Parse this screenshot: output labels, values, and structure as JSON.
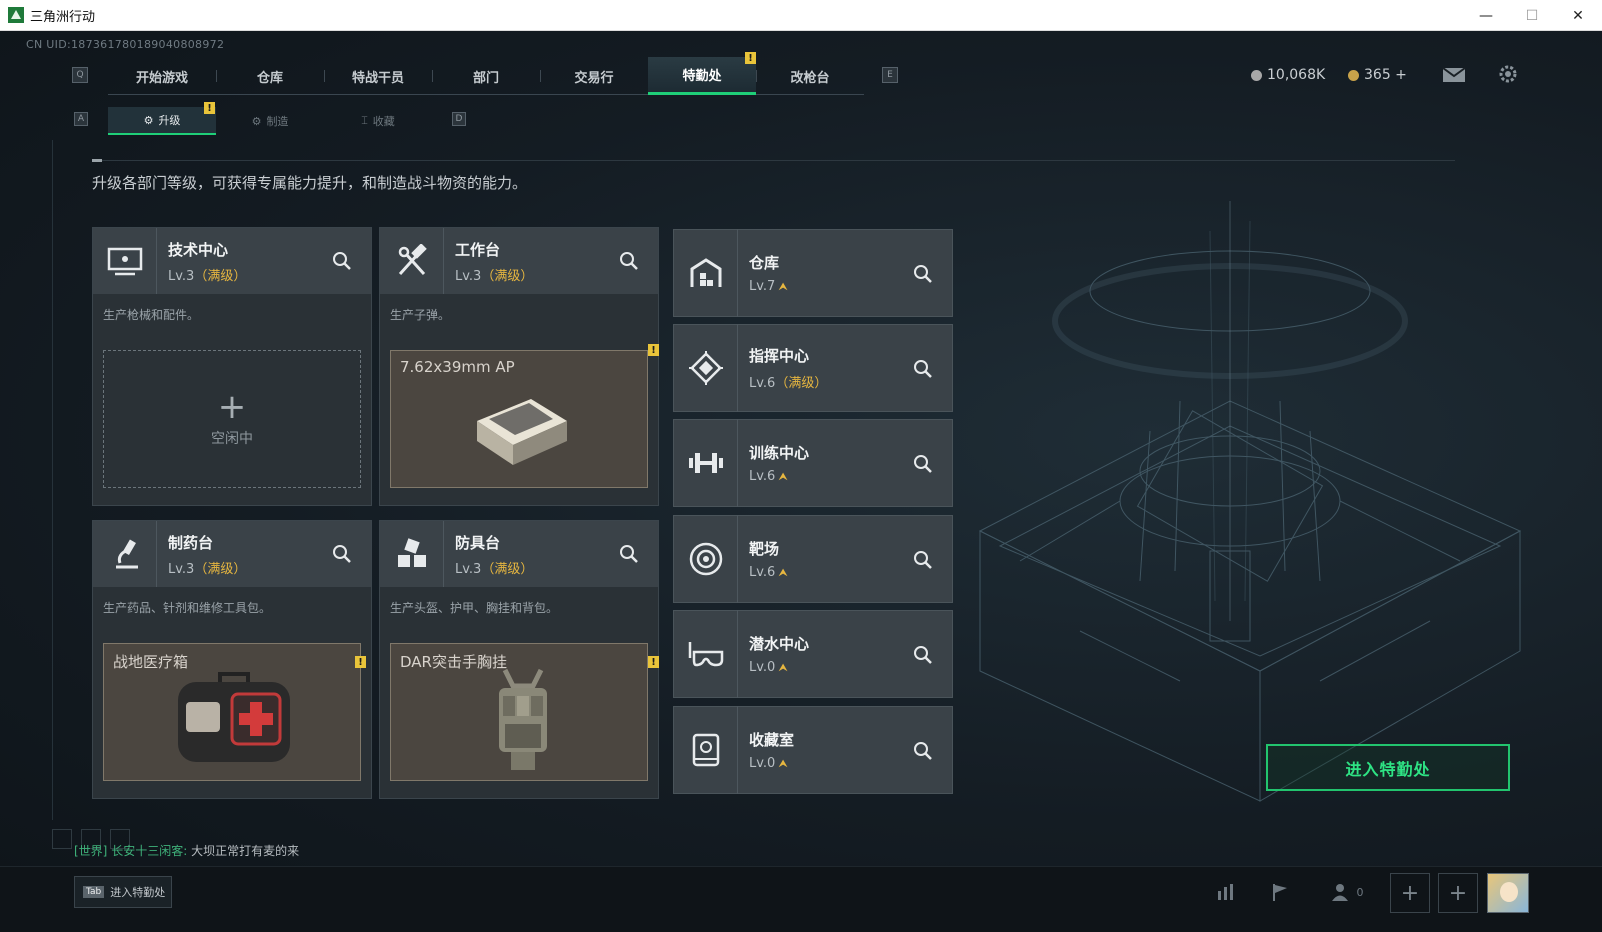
{
  "window": {
    "title": "三角洲行动"
  },
  "header": {
    "uid": "CN UID:187361780189040808972",
    "key_left": "Q",
    "key_right": "E",
    "tabs": [
      {
        "label": "开始游戏",
        "active": false
      },
      {
        "label": "仓库",
        "active": false
      },
      {
        "label": "特战干员",
        "active": false
      },
      {
        "label": "部门",
        "active": false
      },
      {
        "label": "交易行",
        "active": false
      },
      {
        "label": "特勤处",
        "active": true
      },
      {
        "label": "改枪台",
        "active": false
      }
    ],
    "currency": {
      "coins": "10,068K",
      "bonds": "365 +"
    },
    "colors": {
      "accent": "#1fcf78",
      "warning": "#e9c43a",
      "level_max": "#e6b640"
    }
  },
  "subnav": {
    "key_left": "A",
    "key_right": "D",
    "tabs": [
      {
        "label": "升级",
        "icon": "upgrade-icon",
        "active": true
      },
      {
        "label": "制造",
        "icon": "manufacture-icon",
        "active": false
      },
      {
        "label": "收藏",
        "icon": "collection-icon",
        "active": false
      }
    ]
  },
  "description": "升级各部门等级，可获得专属能力提升，和制造战斗物资的能力。",
  "departments_big": [
    {
      "name": "技术中心",
      "level": "Lv.3",
      "max": "（满级）",
      "desc": "生产枪械和配件。",
      "slot_state": "空闲中",
      "icon": "monitor-icon"
    },
    {
      "name": "工作台",
      "level": "Lv.3",
      "max": "（满级）",
      "desc": "生产子弹。",
      "slot_item": "7.62x39mm AP",
      "icon": "hammer-wrench-icon"
    },
    {
      "name": "制药台",
      "level": "Lv.3",
      "max": "（满级）",
      "desc": "生产药品、针剂和维修工具包。",
      "slot_item": "战地医疗箱",
      "icon": "microscope-icon"
    },
    {
      "name": "防具台",
      "level": "Lv.3",
      "max": "（满级）",
      "desc": "生产头盔、护甲、胸挂和背包。",
      "slot_item": "DAR突击手胸挂",
      "icon": "cubes-icon"
    }
  ],
  "departments_small": [
    {
      "name": "仓库",
      "level": "Lv.7",
      "icon": "warehouse-icon"
    },
    {
      "name": "指挥中心",
      "level": "Lv.6",
      "max": "（满级）",
      "icon": "command-icon"
    },
    {
      "name": "训练中心",
      "level": "Lv.6",
      "icon": "dumbbell-icon"
    },
    {
      "name": "靶场",
      "level": "Lv.6",
      "icon": "target-icon"
    },
    {
      "name": "潜水中心",
      "level": "Lv.0",
      "icon": "diving-mask-icon"
    },
    {
      "name": "收藏室",
      "level": "Lv.0",
      "icon": "collection-case-icon"
    }
  ],
  "enter_button": "进入特勤处",
  "chat": {
    "channel": "[世界]",
    "user": "长安十三闲客:",
    "message": "大坝正常打有麦的来"
  },
  "bottombar": {
    "tab_key": "Tab",
    "tab_label": "进入特勤处",
    "friends_count": "0"
  }
}
